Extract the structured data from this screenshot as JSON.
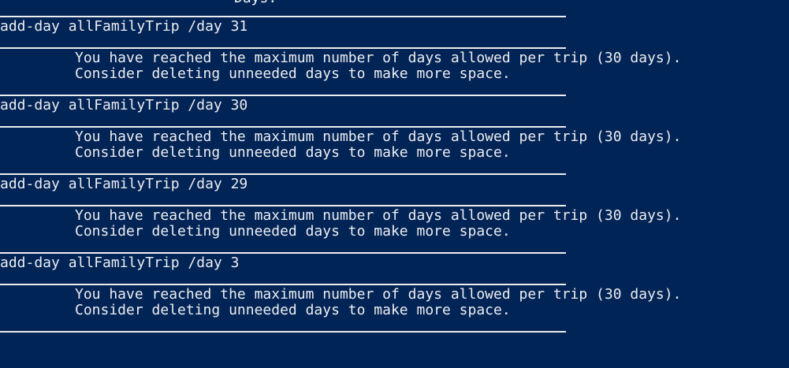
{
  "terminal": {
    "top_partial": "Days.",
    "blocks": [
      {
        "command": "add-day allFamilyTrip /day 31",
        "message_line1": "You have reached the maximum number of days allowed per trip (30 days).",
        "message_line2": "Consider deleting unneeded days to make more space."
      },
      {
        "command": "add-day allFamilyTrip /day 30",
        "message_line1": "You have reached the maximum number of days allowed per trip (30 days).",
        "message_line2": "Consider deleting unneeded days to make more space."
      },
      {
        "command": "add-day allFamilyTrip /day 29",
        "message_line1": "You have reached the maximum number of days allowed per trip (30 days).",
        "message_line2": "Consider deleting unneeded days to make more space."
      },
      {
        "command": "add-day allFamilyTrip /day 3",
        "message_line1": "You have reached the maximum number of days allowed per trip (30 days).",
        "message_line2": "Consider deleting unneeded days to make more space."
      }
    ],
    "colors": {
      "background": "#012456",
      "foreground": "#eeedf0"
    }
  }
}
